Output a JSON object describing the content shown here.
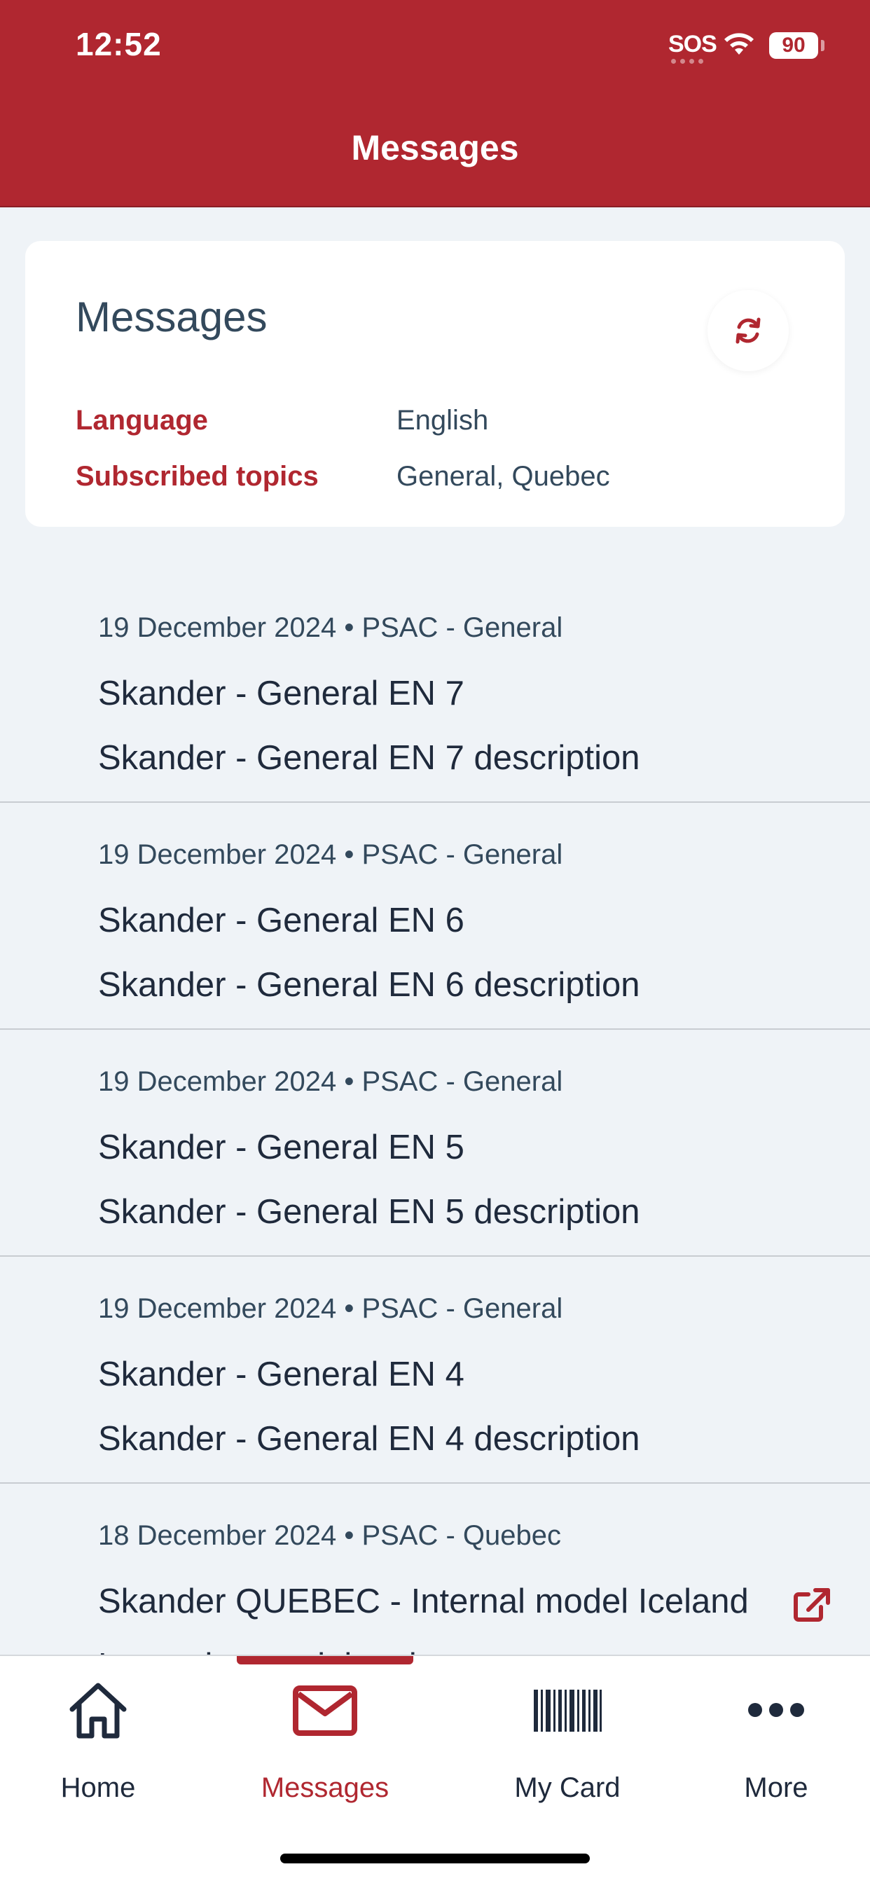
{
  "status_bar": {
    "time": "12:52",
    "sos": "SOS",
    "battery": "90"
  },
  "header": {
    "title": "Messages"
  },
  "card": {
    "title": "Messages",
    "language_label": "Language",
    "language_value": "English",
    "topics_label": "Subscribed topics",
    "topics_value": "General, Quebec"
  },
  "messages": [
    {
      "meta": "19 December 2024 • PSAC - General",
      "title": "Skander - General EN 7",
      "description": "Skander - General EN 7 description"
    },
    {
      "meta": "19 December 2024 • PSAC - General",
      "title": "Skander - General EN 6",
      "description": "Skander - General EN 6 description"
    },
    {
      "meta": "19 December 2024 • PSAC - General",
      "title": "Skander - General EN 5",
      "description": "Skander - General EN 5 description"
    },
    {
      "meta": "19 December 2024 • PSAC - General",
      "title": "Skander - General EN 4",
      "description": "Skander - General EN 4 description"
    },
    {
      "meta": "18 December 2024 • PSAC - Quebec",
      "title": "Skander QUEBEC - Internal model Iceland",
      "description": "Lorem ipsum dolor sit amet, consectetur"
    }
  ],
  "nav": {
    "home": "Home",
    "messages": "Messages",
    "my_card": "My Card",
    "more": "More"
  },
  "colors": {
    "brand": "#b02730",
    "text": "#1f2a3c",
    "muted": "#33495c",
    "background": "#eff3f7"
  }
}
